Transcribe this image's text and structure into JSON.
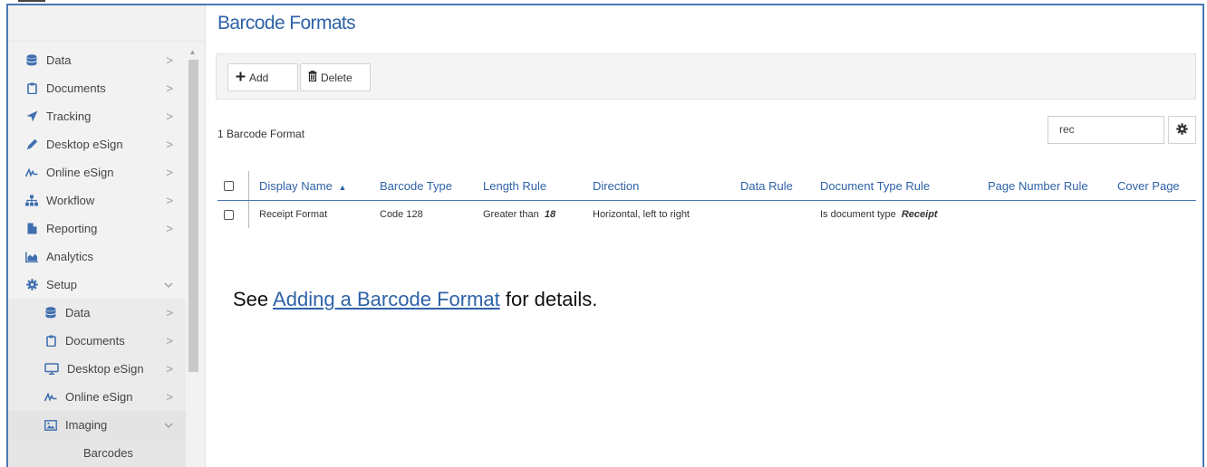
{
  "sidebar": {
    "items": [
      {
        "label": "Data",
        "icon": "database-icon",
        "chevron": ">"
      },
      {
        "label": "Documents",
        "icon": "clipboard-icon",
        "chevron": ">"
      },
      {
        "label": "Tracking",
        "icon": "location-arrow-icon",
        "chevron": ">"
      },
      {
        "label": "Desktop eSign",
        "icon": "pen-icon",
        "chevron": ">"
      },
      {
        "label": "Online eSign",
        "icon": "signature-icon",
        "chevron": ">"
      },
      {
        "label": "Workflow",
        "icon": "sitemap-icon",
        "chevron": ">"
      },
      {
        "label": "Reporting",
        "icon": "file-icon",
        "chevron": ">"
      },
      {
        "label": "Analytics",
        "icon": "chart-area-icon",
        "chevron": ""
      },
      {
        "label": "Setup",
        "icon": "cog-icon",
        "chevron": "v"
      }
    ],
    "setup_items": [
      {
        "label": "Data",
        "icon": "database-icon",
        "chevron": ">"
      },
      {
        "label": "Documents",
        "icon": "clipboard-icon",
        "chevron": ">"
      },
      {
        "label": "Desktop eSign",
        "icon": "desktop-icon",
        "chevron": ">"
      },
      {
        "label": "Online eSign",
        "icon": "signature-icon",
        "chevron": ">"
      },
      {
        "label": "Imaging",
        "icon": "image-icon",
        "chevron": "v"
      }
    ],
    "imaging_items": [
      {
        "label": "Barcodes"
      }
    ]
  },
  "main": {
    "title": "Barcode Formats",
    "toolbar": {
      "add_label": "Add",
      "delete_label": "Delete"
    },
    "count_label": "1 Barcode Format",
    "search_value": "rec",
    "table": {
      "columns": [
        "Display Name",
        "Barcode Type",
        "Length Rule",
        "Direction",
        "Data Rule",
        "Document Type Rule",
        "Page Number Rule",
        "Cover Page"
      ],
      "sort_indicator": "▲",
      "rows": [
        {
          "display_name": "Receipt Format",
          "barcode_type": "Code 128",
          "length_rule_prefix": "Greater than",
          "length_rule_value": "18",
          "direction": "Horizontal, left to right",
          "data_rule": "",
          "doc_type_rule_prefix": "Is document type",
          "doc_type_rule_value": "Receipt",
          "page_number_rule": "",
          "cover_page": ""
        }
      ]
    }
  },
  "caption": {
    "prefix": "See ",
    "link": "Adding a Barcode Format",
    "suffix": " for details."
  },
  "colors": {
    "accent": "#2e62a8",
    "border": "#4a78b5",
    "sidebar_bg": "#f2f2f2"
  }
}
